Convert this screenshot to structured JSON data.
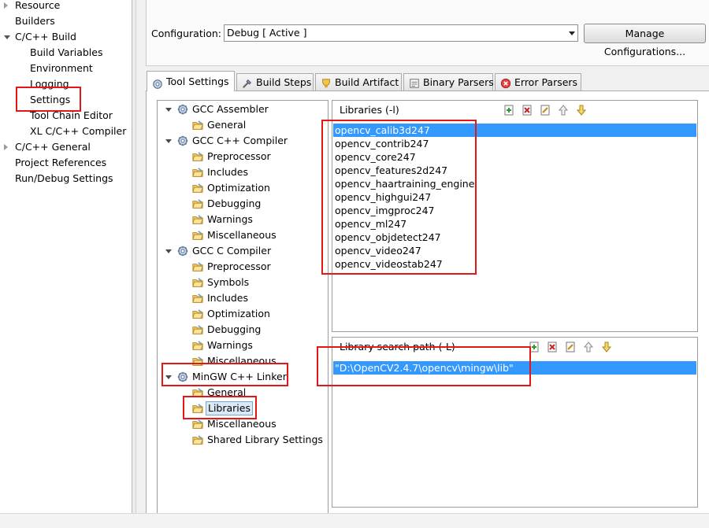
{
  "nav": {
    "items": [
      {
        "label": "Resource",
        "arrow": "closed",
        "level": 0
      },
      {
        "label": "Builders",
        "arrow": "none",
        "level": 0
      },
      {
        "label": "C/C++ Build",
        "arrow": "open",
        "level": 0
      },
      {
        "label": "Build Variables",
        "arrow": "none",
        "level": 1
      },
      {
        "label": "Environment",
        "arrow": "none",
        "level": 1
      },
      {
        "label": "Logging",
        "arrow": "none",
        "level": 1
      },
      {
        "label": "Settings",
        "arrow": "none",
        "level": 1,
        "highlighted": true
      },
      {
        "label": "Tool Chain Editor",
        "arrow": "none",
        "level": 1
      },
      {
        "label": "XL C/C++ Compiler",
        "arrow": "none",
        "level": 1
      },
      {
        "label": "C/C++ General",
        "arrow": "closed",
        "level": 0
      },
      {
        "label": "Project References",
        "arrow": "none",
        "level": 0
      },
      {
        "label": "Run/Debug Settings",
        "arrow": "none",
        "level": 0
      }
    ]
  },
  "config": {
    "label": "Configuration:",
    "value": "Debug  [ Active ]",
    "manage_label": "Manage Configurations..."
  },
  "tabs": [
    {
      "label": "Tool Settings",
      "icon": "tool-settings-icon",
      "active": true
    },
    {
      "label": "Build Steps",
      "icon": "build-steps-icon"
    },
    {
      "label": "Build Artifact",
      "icon": "build-artifact-icon"
    },
    {
      "label": "Binary Parsers",
      "icon": "binary-parsers-icon"
    },
    {
      "label": "Error Parsers",
      "icon": "error-parsers-icon"
    }
  ],
  "tree": {
    "items": [
      {
        "label": "GCC Assembler",
        "type": "tool"
      },
      {
        "label": "General",
        "type": "option"
      },
      {
        "label": "GCC C++ Compiler",
        "type": "tool"
      },
      {
        "label": "Preprocessor",
        "type": "option"
      },
      {
        "label": "Includes",
        "type": "option"
      },
      {
        "label": "Optimization",
        "type": "option"
      },
      {
        "label": "Debugging",
        "type": "option"
      },
      {
        "label": "Warnings",
        "type": "option"
      },
      {
        "label": "Miscellaneous",
        "type": "option"
      },
      {
        "label": "GCC C Compiler",
        "type": "tool"
      },
      {
        "label": "Preprocessor",
        "type": "option"
      },
      {
        "label": "Symbols",
        "type": "option"
      },
      {
        "label": "Includes",
        "type": "option"
      },
      {
        "label": "Optimization",
        "type": "option"
      },
      {
        "label": "Debugging",
        "type": "option"
      },
      {
        "label": "Warnings",
        "type": "option"
      },
      {
        "label": "Miscellaneous",
        "type": "option"
      },
      {
        "label": "MinGW C++ Linker",
        "type": "tool"
      },
      {
        "label": "General",
        "type": "option"
      },
      {
        "label": "Libraries",
        "type": "option",
        "selected": true
      },
      {
        "label": "Miscellaneous",
        "type": "option"
      },
      {
        "label": "Shared Library Settings",
        "type": "option"
      }
    ]
  },
  "libraries": {
    "title": "Libraries (-l)",
    "toolbar": [
      "add-icon",
      "delete-icon",
      "edit-icon",
      "move-up-icon",
      "move-down-icon"
    ],
    "items": [
      "opencv_calib3d247",
      "opencv_contrib247",
      "opencv_core247",
      "opencv_features2d247",
      "opencv_haartraining_engine",
      "opencv_highgui247",
      "opencv_imgproc247",
      "opencv_ml247",
      "opencv_objdetect247",
      "opencv_video247",
      "opencv_videostab247"
    ],
    "selected_index": 0
  },
  "search_paths": {
    "title": "Library search path (-L)",
    "toolbar": [
      "add-icon",
      "delete-icon",
      "edit-icon",
      "move-up-icon",
      "move-down-icon"
    ],
    "items": [
      "\"D:\\OpenCV2.4.7\\opencv\\mingw\\lib\""
    ],
    "selected_index": 0
  },
  "colors": {
    "selection": "#3399ff",
    "highlight_box": "#e01818"
  }
}
